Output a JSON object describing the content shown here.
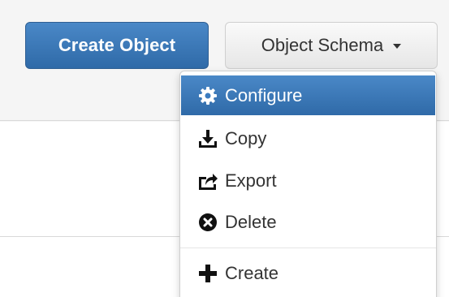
{
  "toolbar": {
    "create_object_label": "Create Object",
    "object_schema_label": "Object Schema"
  },
  "dropdown": {
    "items": [
      {
        "label": "Configure",
        "icon": "gear-icon",
        "active": true
      },
      {
        "label": "Copy",
        "icon": "download-icon",
        "active": false
      },
      {
        "label": "Export",
        "icon": "export-icon",
        "active": false
      },
      {
        "label": "Delete",
        "icon": "remove-circle-icon",
        "active": false
      },
      {
        "label": "Create",
        "icon": "plus-icon",
        "active": false
      }
    ]
  },
  "colors": {
    "primary": "#337ab7",
    "active_bg": "#2f6aa8",
    "text": "#333333",
    "toolbar_bg": "#f5f5f5"
  }
}
